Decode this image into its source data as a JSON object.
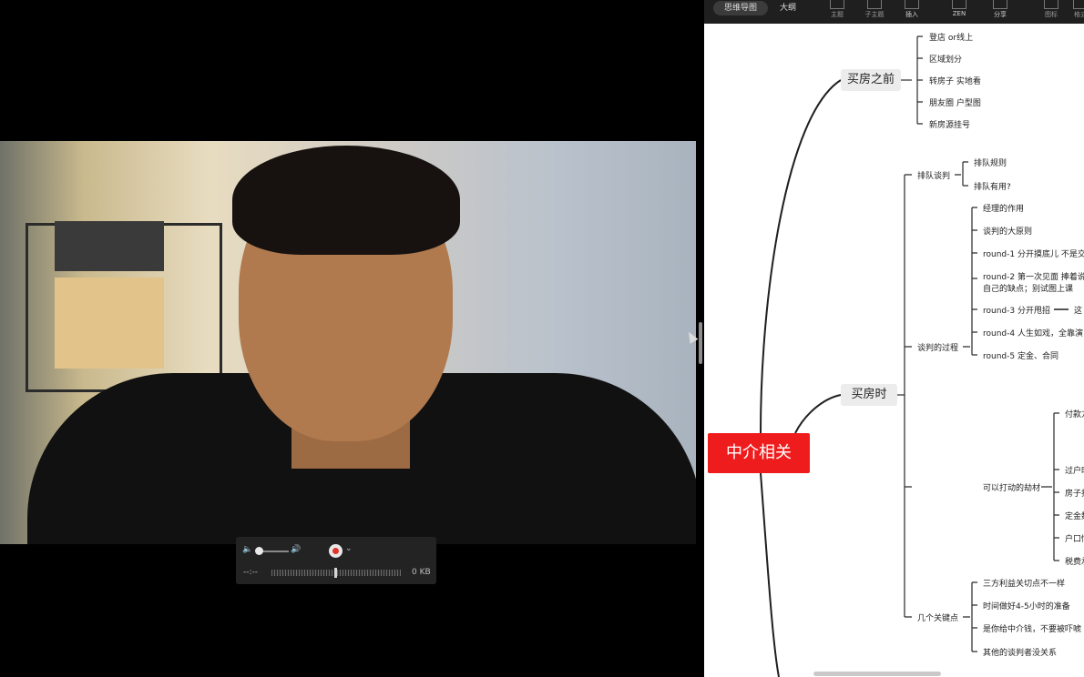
{
  "player": {
    "time": "--:--",
    "size": "0 KB",
    "volume_level": 0.0,
    "icons": [
      "speaker-low-icon",
      "speaker-high-icon",
      "record-icon",
      "chevron-down-icon"
    ]
  },
  "mindmap": {
    "tabs": [
      "思维导图",
      "大纲"
    ],
    "toolbar": [
      "主题",
      "子主题",
      "插入",
      "ZEN",
      "分享",
      "图标",
      "格式"
    ],
    "root": "中介相关",
    "before": {
      "title": "买房之前",
      "items": [
        "登店 or线上",
        "区域划分",
        "转房子  实地看",
        "朋友圈 户型图",
        "新房源挂号"
      ]
    },
    "during": {
      "title": "买房时",
      "queue": {
        "title": "排队谈判",
        "items": [
          "排队规则",
          "排队有用?"
        ]
      },
      "process": {
        "title": "谈判的过程",
        "items": [
          "经理的作用",
          "谈判的大原则",
          "round-1 分开摸底儿  不是交",
          "round-2 第一次见面  捧着说",
          "自己的缺点；别试图上课",
          "round-3 分开甩招",
          "这",
          "round-4 人生如戏，全靠演",
          "round-5 定金、合同"
        ]
      },
      "chips": {
        "title": "可以打动的劫材",
        "items": [
          "付款方",
          "过户时",
          "房子打",
          "定金数",
          "户口情",
          "税费承"
        ]
      },
      "keys": {
        "title": "几个关键点",
        "items": [
          "三方利益关切点不一样",
          "时间做好4-5小时的准备",
          "是你给中介钱，不要被吓唬",
          "其他的谈判者没关系"
        ]
      }
    }
  }
}
